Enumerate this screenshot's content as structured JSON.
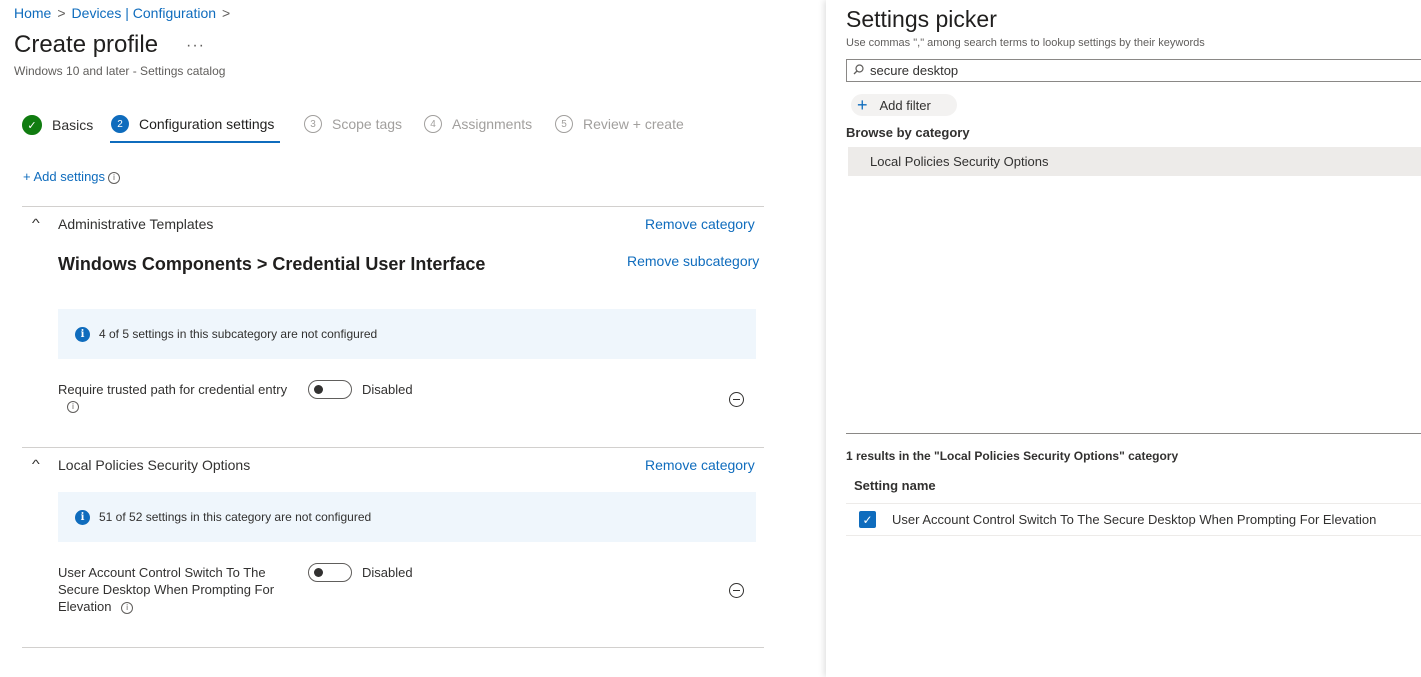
{
  "breadcrumb": {
    "home": "Home",
    "sep": ">",
    "devices": "Devices | Configuration"
  },
  "page": {
    "title": "Create profile",
    "more": "···",
    "subtitle": "Windows 10 and later - Settings catalog"
  },
  "steps": [
    {
      "num": "✓",
      "label": "Basics",
      "state": "done"
    },
    {
      "num": "2",
      "label": "Configuration settings",
      "state": "active"
    },
    {
      "num": "3",
      "label": "Scope tags",
      "state": "inactive"
    },
    {
      "num": "4",
      "label": "Assignments",
      "state": "inactive"
    },
    {
      "num": "5",
      "label": "Review + create",
      "state": "inactive"
    }
  ],
  "add_settings": {
    "label": "+ Add settings",
    "info": "i"
  },
  "categories": [
    {
      "chevron": "^",
      "name": "Administrative Templates",
      "remove": "Remove category",
      "subcategory": "Windows Components > Credential User Interface",
      "remove_sub": "Remove subcategory",
      "info": "4 of 5 settings in this subcategory are not configured",
      "setting": {
        "label": "Require trusted path for credential entry",
        "toggle": "Disabled"
      }
    },
    {
      "chevron": "^",
      "name": "Local Policies Security Options",
      "remove": "Remove category",
      "info": "51 of 52 settings in this category are not configured",
      "setting": {
        "label_lines": [
          "User Account Control Switch To The",
          "Secure Desktop When Prompting For",
          "Elevation"
        ],
        "toggle": "Disabled"
      }
    }
  ],
  "picker": {
    "title": "Settings picker",
    "hint": "Use commas \",\" among search terms to lookup settings by their keywords",
    "search_value": "secure desktop",
    "add_filter": "Add filter",
    "browse_label": "Browse by category",
    "category": "Local Policies Security Options",
    "results": "1 results in the \"Local Policies Security Options\" category",
    "col_header": "Setting name",
    "result_item": "User Account Control Switch To The Secure Desktop When Prompting For Elevation",
    "result_checked": true
  },
  "colors": {
    "accent": "#0f6cbd",
    "success": "#107c10",
    "infobar": "#eff6fc"
  },
  "icons": [
    "chevron-right-icon",
    "check-icon",
    "info-icon",
    "chevron-up-icon",
    "remove-circle-icon",
    "search-icon",
    "add-icon",
    "checkbox-checked-icon"
  ]
}
